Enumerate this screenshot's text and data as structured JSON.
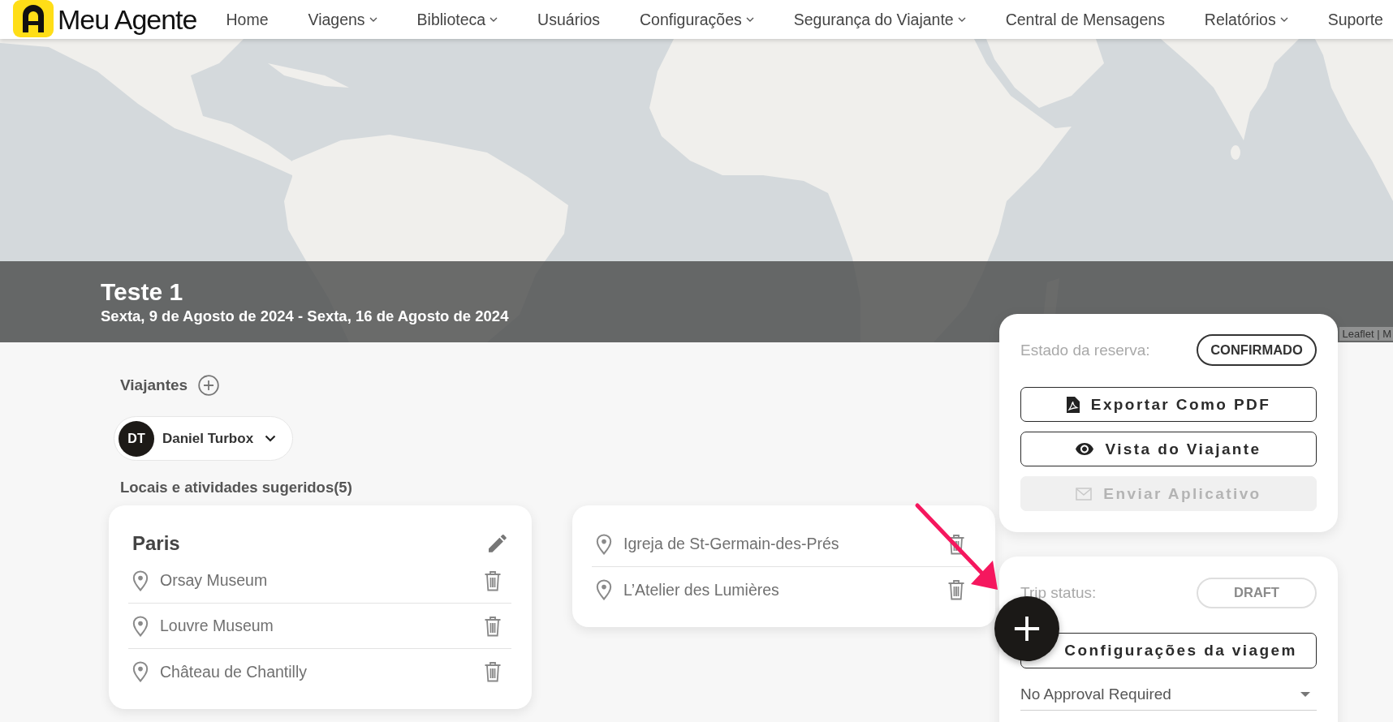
{
  "nav": {
    "logo": "Meu Agente",
    "items": [
      {
        "label": "Home",
        "dropdown": false
      },
      {
        "label": "Viagens",
        "dropdown": true
      },
      {
        "label": "Biblioteca",
        "dropdown": true
      },
      {
        "label": "Usuários",
        "dropdown": false
      },
      {
        "label": "Configurações",
        "dropdown": true
      },
      {
        "label": "Segurança do Viajante",
        "dropdown": true
      },
      {
        "label": "Central de Mensagens",
        "dropdown": false
      },
      {
        "label": "Relatórios",
        "dropdown": true
      },
      {
        "label": "Suporte",
        "dropdown": false
      }
    ]
  },
  "map": {
    "attribution": "Leaflet | M"
  },
  "trip": {
    "title": "Teste 1",
    "dates": "Sexta, 9 de Agosto de 2024 - Sexta, 16 de Agosto de 2024"
  },
  "travelers": {
    "heading": "Viajantes",
    "people": [
      {
        "initials": "DT",
        "name": "Daniel Turbox"
      }
    ]
  },
  "suggestions": {
    "heading": "Locais e atividades sugeridos(5)",
    "cards": [
      {
        "title": "Paris",
        "places": [
          "Orsay Museum",
          "Louvre Museum",
          "Château de Chantilly"
        ]
      },
      {
        "places": [
          "Igreja de St-Germain-des-Prés",
          "L’Atelier des Lumières"
        ]
      }
    ]
  },
  "booking": {
    "label": "Estado da reserva:",
    "status": {
      "text": "CONFIRMADO",
      "disabled": false
    },
    "buttons": [
      {
        "label": "Exportar Como PDF",
        "kind": "pdf",
        "disabled": false
      },
      {
        "label": "Vista do Viajante",
        "kind": "eye",
        "disabled": false
      },
      {
        "label": "Enviar Aplicativo",
        "kind": "mail",
        "disabled": true
      }
    ]
  },
  "trip_status": {
    "label": "Trip status:",
    "status": {
      "text": "DRAFT",
      "disabled": true
    },
    "settings_button": "Configurações da viagem",
    "approval": {
      "value": "No Approval Required"
    }
  }
}
